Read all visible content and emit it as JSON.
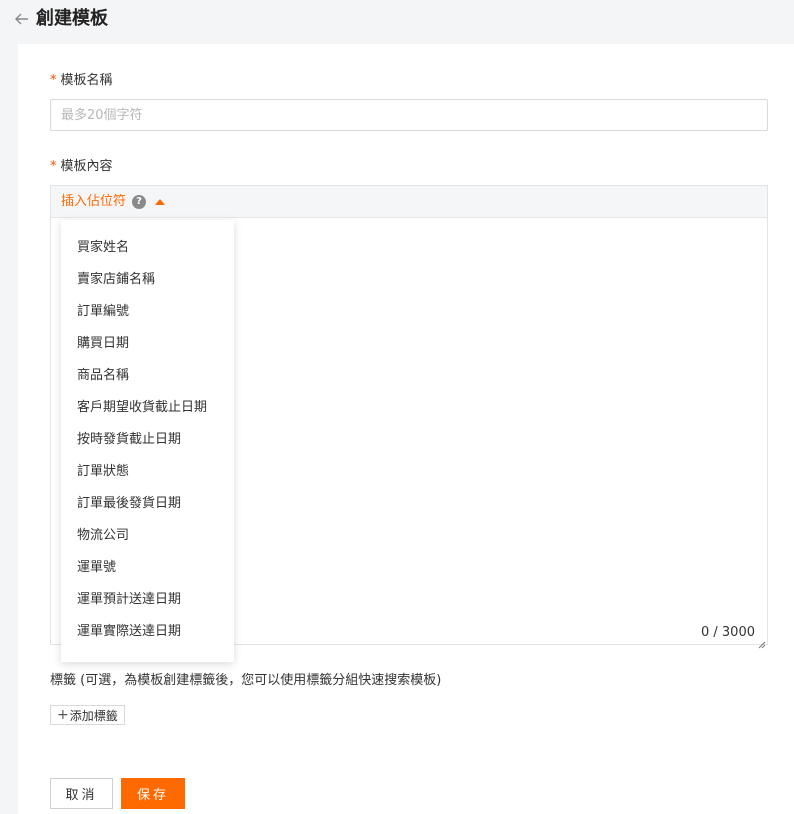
{
  "header": {
    "title": "創建模板",
    "back_icon": "arrow-left-icon"
  },
  "form": {
    "name_label": "模板名稱",
    "required_mark": "*",
    "name_placeholder": "最多20個字符",
    "name_value": "",
    "content_label": "模板內容",
    "insert_placeholder_label": "插入佔位符",
    "help_icon_glyph": "?",
    "char_counter": "0 / 3000",
    "tags_label": "標籤 (可選，為模板創建標籤後，您可以使用標籤分組快速搜索模板)",
    "add_tag_label": "添加標籤",
    "add_tag_icon": "+"
  },
  "placeholder_menu": {
    "items": [
      "買家姓名",
      "賣家店鋪名稱",
      "訂單編號",
      "購買日期",
      "商品名稱",
      "客戶期望收貨截止日期",
      "按時發貨截止日期",
      "訂單狀態",
      "訂單最後發貨日期",
      "物流公司",
      "運單號",
      "運單預計送達日期",
      "運單實際送達日期"
    ]
  },
  "actions": {
    "cancel_label": "取消",
    "save_label": "保存"
  },
  "colors": {
    "accent": "#ff6a00",
    "required": "#ff5000",
    "page_bg": "#f4f5f7"
  }
}
